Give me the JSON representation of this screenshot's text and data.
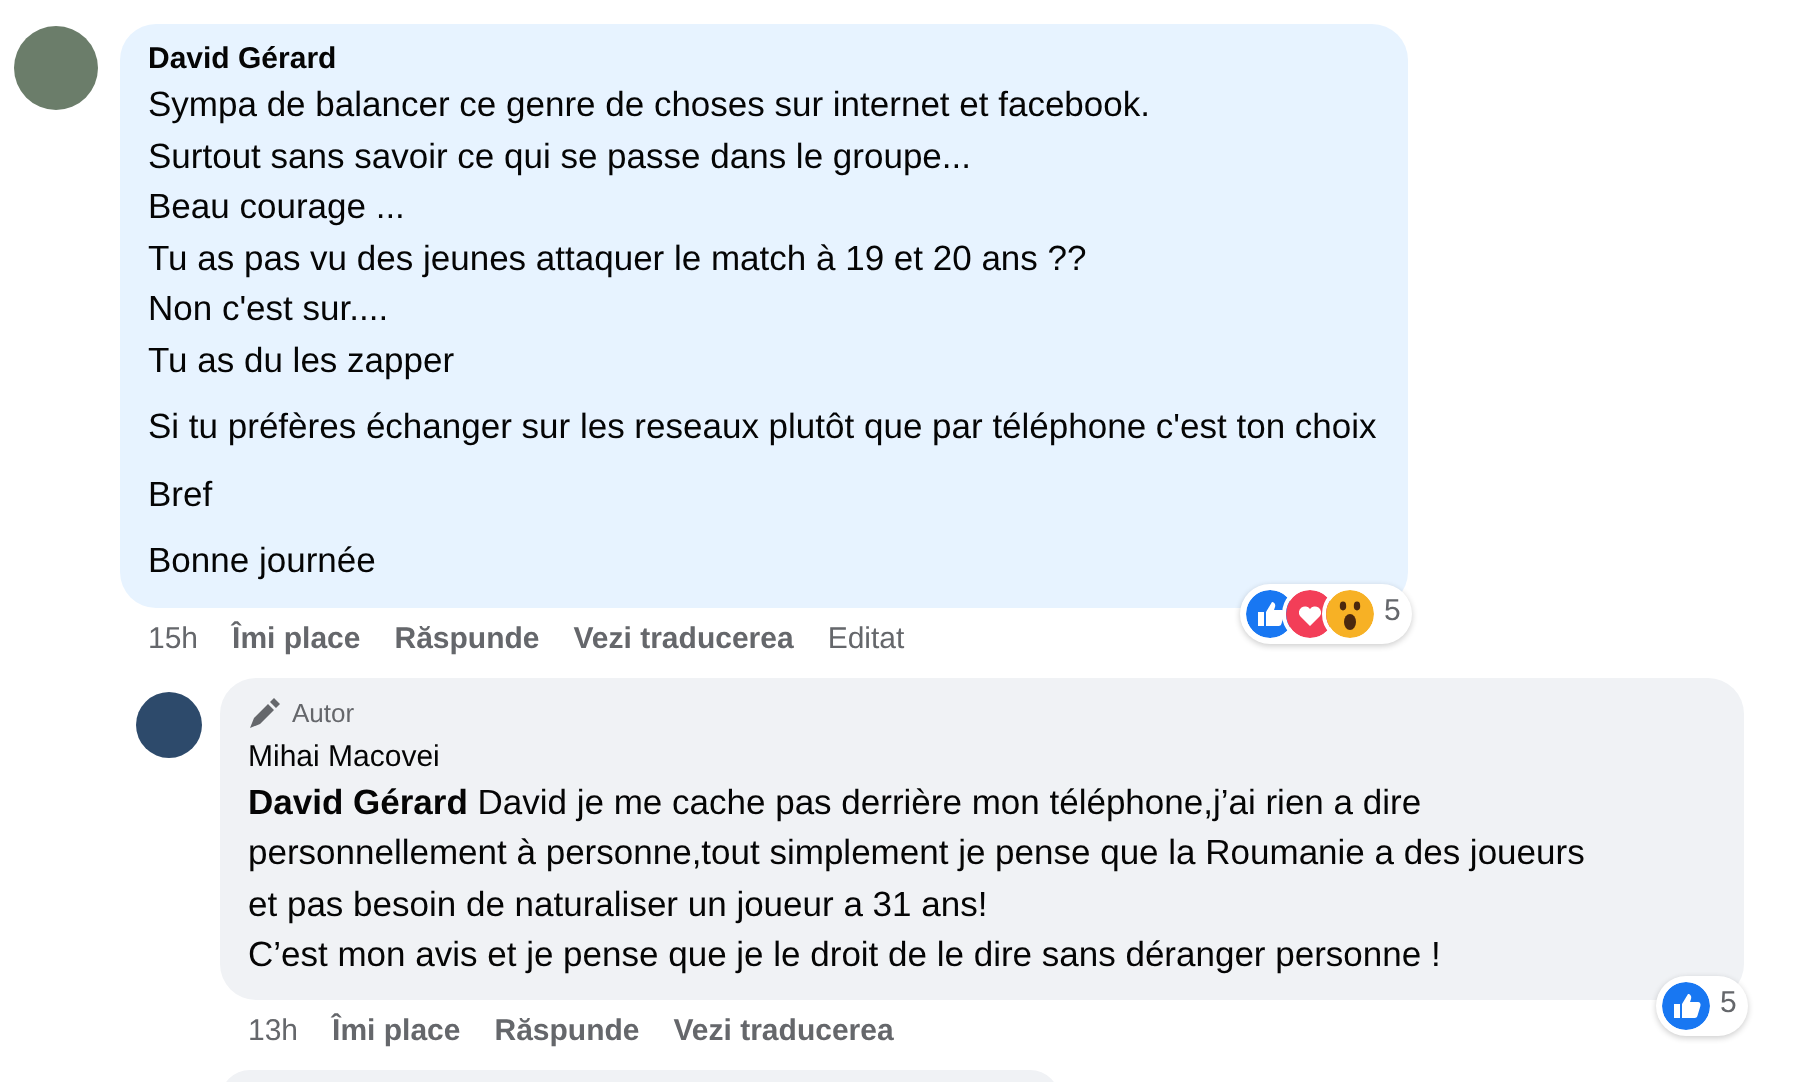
{
  "comments": [
    {
      "author": "David Gérard",
      "indent": false,
      "paragraphs": [
        "Sympa de balancer ce genre de choses sur internet et facebook.\nSurtout sans savoir ce qui se passe dans le groupe...\nBeau courage ...\nTu as pas vu des jeunes attaquer le match à 19 et 20 ans ??\nNon c'est sur....\nTu as du les zapper",
        "Si tu préfères échanger sur les reseaux plutôt que par téléphone c'est ton choix",
        "Bref",
        "Bonne journée"
      ],
      "time": "15h",
      "actions": [
        "Îmi place",
        "Răspunde",
        "Vezi traducerea"
      ],
      "edited": "Editat",
      "reactions": [
        {
          "kind": "like"
        },
        {
          "kind": "love"
        },
        {
          "kind": "wow"
        }
      ],
      "reaction_count": "5"
    },
    {
      "author": "Mihai Macovei",
      "indent": true,
      "badge": "Autor",
      "paragraphs": [
        "**David Gérard** David je me cache pas derrière mon téléphone,j’ai rien a dire\npersonnellement à personne,tout simplement je pense que la Roumanie a des joueurs\net pas besoin de naturaliser un joueur a 31 ans!\nC’est mon avis et je pense que je le droit de le dire sans déranger personne !"
      ],
      "time": "13h",
      "actions": [
        "Îmi place",
        "Răspunde",
        "Vezi traducerea"
      ],
      "reactions": [
        {
          "kind": "like"
        }
      ],
      "reaction_count": "5"
    }
  ]
}
